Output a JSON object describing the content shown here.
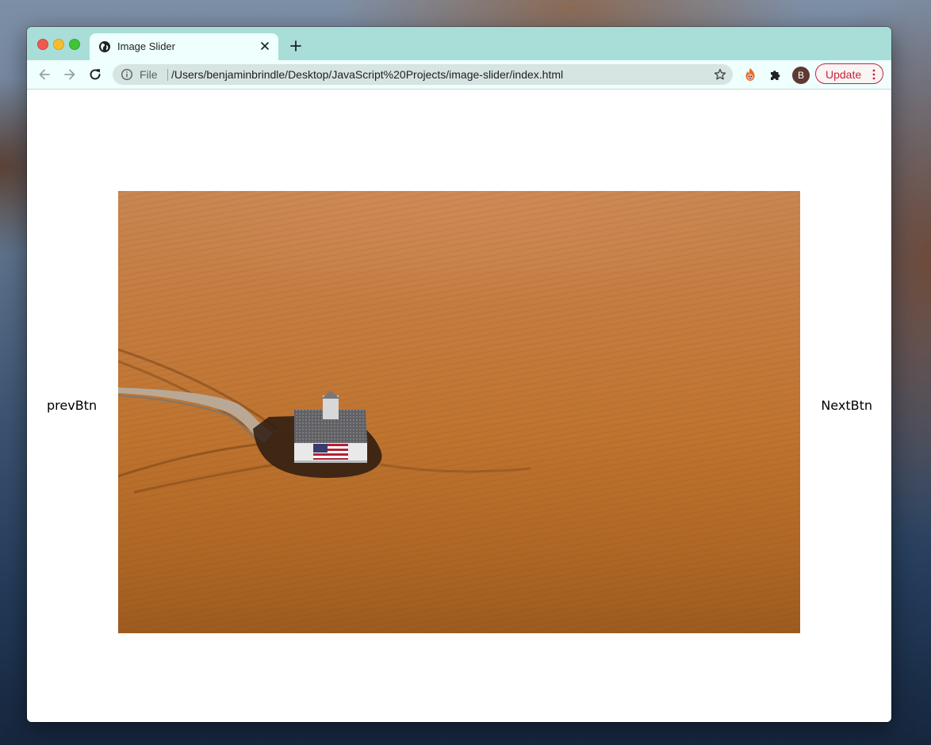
{
  "browser": {
    "tab": {
      "title": "Image Slider",
      "favicon_icon": "globe-icon"
    },
    "toolbar": {
      "back_icon": "back-arrow-icon",
      "forward_icon": "forward-arrow-icon",
      "reload_icon": "reload-icon",
      "site_info_icon": "info-icon",
      "scheme_label": "File",
      "url": "/Users/benjaminbrindle/Desktop/JavaScript%20Projects/image-slider/index.html",
      "bookmark_icon": "star-icon",
      "extension_icons": [
        "flame-extension-icon",
        "puzzle-piece-icon"
      ],
      "avatar_initial": "B",
      "update_label": "Update"
    }
  },
  "slider": {
    "prev_label": "prevBtn",
    "next_label": "NextBtn"
  },
  "colors": {
    "tab_strip": "#a9ddd8",
    "toolbar_bg": "#eefffd",
    "update_accent": "#c2253b",
    "avatar_bg": "#5e3a32"
  }
}
